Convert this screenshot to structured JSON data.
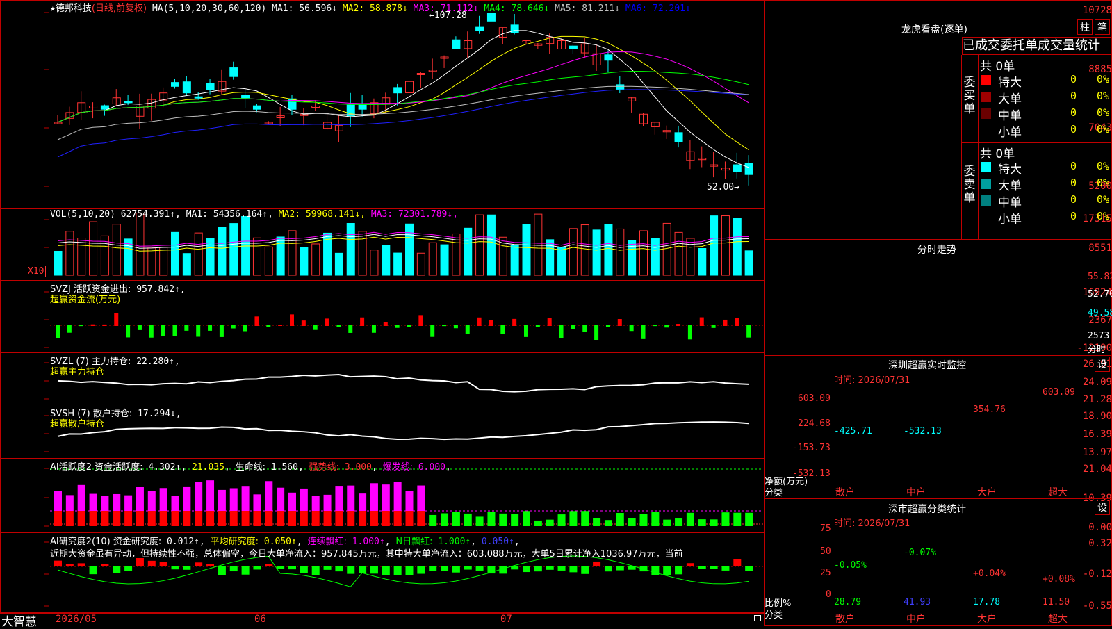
{
  "main_chart": {
    "title": "德邦科技",
    "title_star": "★",
    "period": "(日线,前复权)",
    "ma_label": "MA(5,10,20,30,60,120)",
    "ma_values": [
      {
        "label": "MA1:",
        "value": "56.596↓",
        "color": "#ffffff"
      },
      {
        "label": "MA2:",
        "value": "58.878↓",
        "color": "#ffff00"
      },
      {
        "label": "MA3:",
        "value": "71.112↓",
        "color": "#ff00ff"
      },
      {
        "label": "MA4:",
        "value": "78.646↓",
        "color": "#00ff00"
      },
      {
        "label": "MA5:",
        "value": "81.211↓",
        "color": "#c0c0c0"
      },
      {
        "label": "MA6:",
        "value": "72.201↓",
        "color": "#0000ff"
      }
    ],
    "y_axis": [
      "10728",
      "8885",
      "7043",
      "5200"
    ],
    "high_marker": "107.28",
    "low_marker": "52.00"
  },
  "volume_panel": {
    "title": "VOL(5,10,20)",
    "value": "62754.391↑",
    "ma": [
      {
        "label": "MA1:",
        "value": "54356.164↑",
        "color": "#ffffff"
      },
      {
        "label": "MA2:",
        "value": "59968.141↓",
        "color": "#ffff00"
      },
      {
        "label": "MA3:",
        "value": "72301.789↓",
        "color": "#ff00ff"
      }
    ],
    "y_axis": [
      "17315",
      "8551"
    ],
    "unit": "X10"
  },
  "svzj_panel": {
    "title": "SVZJ 活跃资金进出:",
    "value": "957.842↑",
    "subtitle": "超赢资金流(万元)",
    "y_axis": [
      "16924",
      "2367",
      "-12190"
    ]
  },
  "svzl_panel": {
    "title": "SVZL (7) 主力持仓:",
    "value": "22.280↑",
    "subtitle": "超赢主力持仓",
    "y_axis": [
      "26.91",
      "24.09",
      "21.28"
    ]
  },
  "svsh_panel": {
    "title": "SVSH (7) 散户持仓:",
    "value": "17.294↓",
    "subtitle": "超赢散户持仓",
    "y_axis": [
      "18.90",
      "16.39",
      "13.97"
    ]
  },
  "ai_active_panel": {
    "title": "AI活跃度2 资金活跃度:",
    "value": "4.302↑",
    "v2": "21.035",
    "life_label": "生命线:",
    "life_value": "1.560",
    "strong_label": "强势线:",
    "strong_value": "3.000",
    "burst_label": "爆发线:",
    "burst_value": "6.000",
    "y_axis": [
      "21.04",
      "10.39",
      "0.00"
    ]
  },
  "ai_research_panel": {
    "title": "AI研究度2(10) 资金研究度:",
    "value": "0.012↑",
    "avg_label": "平均研究度:",
    "avg_value": "0.050↑",
    "red_label": "连续飘红:",
    "red_value": "1.000↑",
    "nred_label": "N日飘红:",
    "nred_value": "1.000↑",
    "last_value": "0.050↑",
    "comment": "近期大资金虽有异动，但持续性不强，总体偏空，今日大单净流入：957.845万元，其中特大单净流入：603.088万元，大单5日累计净入1036.97万元，当前",
    "y_axis": [
      "0.32",
      "-0.12",
      "-0.55"
    ]
  },
  "x_axis": {
    "labels": [
      "2026/05",
      "06",
      "07"
    ],
    "corner": "大智慧"
  },
  "dragon_tiger": {
    "title": "龙虎看盘(逐单)",
    "btn_bar": "柱",
    "btn_pen": "笔",
    "tabs": "已成交委托单成交量统计",
    "buy_side": "委买单",
    "sell_side": "委卖单",
    "buy_total": "共 0单",
    "sell_total": "共 0单",
    "buy_rows": [
      {
        "label": "特大",
        "count": "0",
        "pct": "0%",
        "color": "#ff0000"
      },
      {
        "label": "大单",
        "count": "0",
        "pct": "0%",
        "color": "#a00000"
      },
      {
        "label": "中单",
        "count": "0",
        "pct": "0%",
        "color": "#6a0000"
      },
      {
        "label": "小单",
        "count": "0",
        "pct": "0%",
        "color": "#000000"
      }
    ],
    "sell_rows": [
      {
        "label": "特大",
        "count": "0",
        "pct": "0%",
        "color": "#00ffff"
      },
      {
        "label": "大单",
        "count": "0",
        "pct": "0%",
        "color": "#00a0a0"
      },
      {
        "label": "中单",
        "count": "0",
        "pct": "0%",
        "color": "#008080"
      },
      {
        "label": "小单",
        "count": "0",
        "pct": "0%",
        "color": "#000000"
      }
    ]
  },
  "intraday": {
    "title": "分时走势",
    "prices": [
      "55.82",
      "52.70",
      "49.58"
    ],
    "volume": "2573",
    "vol_unit": "分时"
  },
  "sz_monitor": {
    "title": "深圳超赢实时监控",
    "settings": "设",
    "time": "时间: 2026/07/31",
    "y_axis": [
      "603.09",
      "224.68",
      "-153.73",
      "-532.13"
    ],
    "axis_title": "净额(万元)",
    "axis_sub": "分类",
    "categories": [
      "散户",
      "中户",
      "大户",
      "超大"
    ],
    "values": [
      "-425.71",
      "-532.13",
      "354.76",
      "603.09"
    ]
  },
  "sz_classify": {
    "title": "深市超赢分类统计",
    "settings": "设",
    "time": "时间: 2026/07/31",
    "y_axis": [
      "75",
      "50",
      "25",
      "0"
    ],
    "axis_title": "比例%",
    "axis_sub": "分类",
    "categories": [
      "散户",
      "中户",
      "大户",
      "超大"
    ],
    "top_values": [
      "-0.05%",
      "-0.07%",
      "+0.04%",
      "+0.08%"
    ],
    "bottom_values": [
      "28.79",
      "41.93",
      "17.78",
      "11.50"
    ]
  }
}
